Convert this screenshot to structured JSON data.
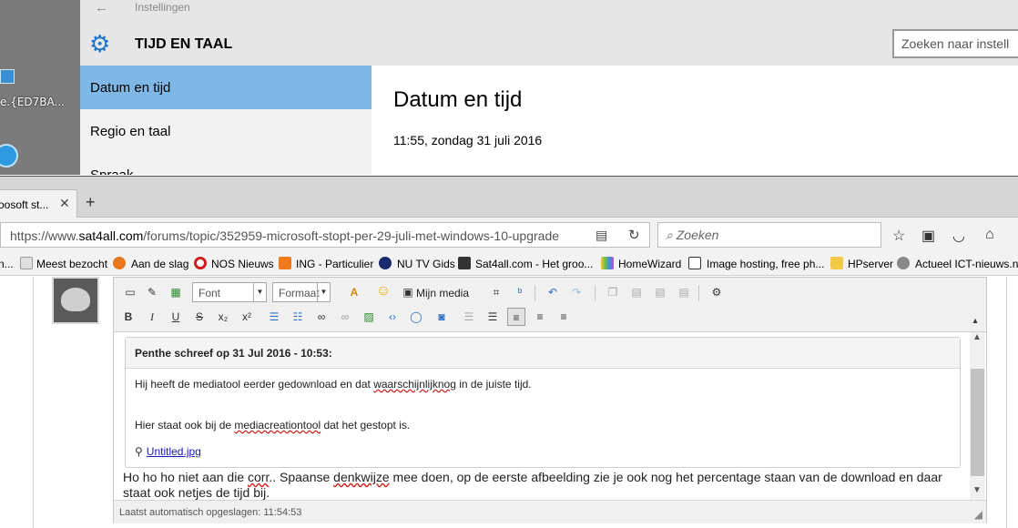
{
  "desktop": {
    "icon_label": "e.{ED7BA..."
  },
  "settings": {
    "back_glyph": "←",
    "app_title": "Instellingen",
    "section_title": "TIJD EN TAAL",
    "search_placeholder": "Zoeken naar instell",
    "nav": [
      "Datum en tijd",
      "Regio en taal",
      "Spraak"
    ],
    "content_title": "Datum en tijd",
    "content_time": "11:55, zondag 31 juli 2016"
  },
  "browser": {
    "tab_title": "oosoft st...",
    "tab_close": "✕",
    "new_tab": "+",
    "url_prefix": "https://www.",
    "url_host": "sat4all.com",
    "url_path": "/forums/topic/352959-microsoft-stopt-per-29-juli-met-windows-10-upgrade",
    "search_placeholder": "Zoeken",
    "bookmarks": [
      "n...",
      "Meest bezocht",
      "Aan de slag",
      "NOS Nieuws",
      "ING - Particulier",
      "NU TV Gids",
      "Sat4all.com - Het groo...",
      "HomeWizard",
      "Image hosting, free ph...",
      "HPserver",
      "Actueel ICT-nieuws.n"
    ]
  },
  "editor": {
    "font_dropdown": "Font",
    "format_dropdown": "Formaat",
    "media_button": "Mijn media",
    "quote_header": "Penthe schreef op 31 Jul 2016 - 10:53:",
    "quote_line1_a": "Hij heeft de mediatool eerder gedownload en dat ",
    "quote_line1_err": "waarschijnlijknog",
    "quote_line1_b": " in de juiste tijd.",
    "quote_line2_a": "Hier staat ook bij de ",
    "quote_line2_err": "mediacreationtool",
    "quote_line2_b": " dat het gestopt is.",
    "attachment": "Untitled.jpg",
    "reply_a": "Ho ho ho niet aan die ",
    "reply_err1": "corr",
    "reply_b": ".. Spaanse ",
    "reply_err2": "denkwijze",
    "reply_c": " mee doen, op de eerste afbeelding zie je ook nog het percentage staan van de download en daar staat ook netjes de tijd bij.",
    "status": "Laatst automatisch opgeslagen: 11:54:53"
  },
  "colors": {
    "settings_accent": "#1e73c9",
    "nav_active": "#7fb7e6",
    "spell_error": "#d02020"
  }
}
